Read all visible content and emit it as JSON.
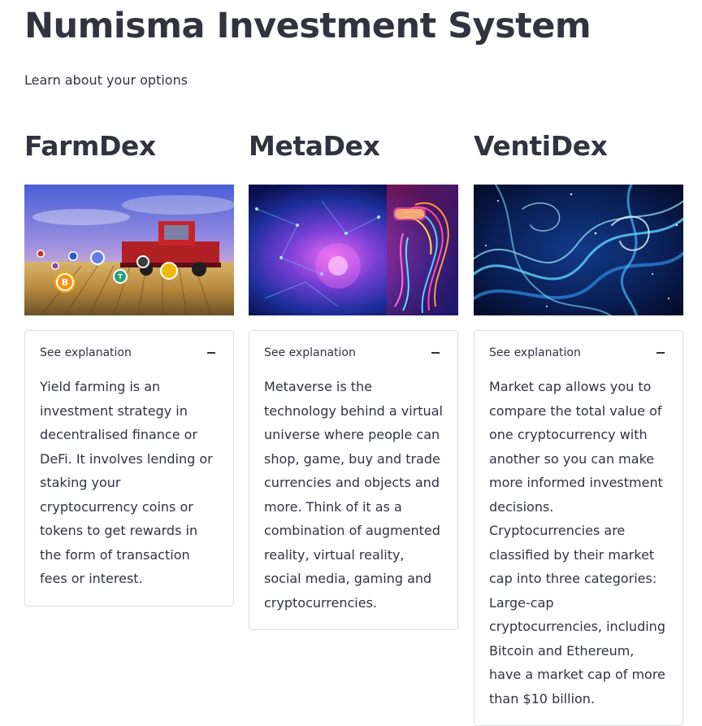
{
  "header": {
    "title": "Numisma Investment System",
    "subtitle": "Learn about your options"
  },
  "columns": [
    {
      "title": "FarmDex",
      "expander_label": "See explanation",
      "explanation": "Yield farming is an investment strategy in decentralised finance or DeFi. It involves lending or staking your cryptocurrency coins or tokens to get rewards in the form of transaction fees or interest."
    },
    {
      "title": "MetaDex",
      "expander_label": "See explanation",
      "explanation": "Metaverse is the technology behind a virtual universe where people can shop, game, buy and trade currencies and objects and more. Think of it as a combination of augmented reality, virtual reality, social media, gaming and cryptocurrencies."
    },
    {
      "title": "VentiDex",
      "expander_label": "See explanation",
      "explanation": "Market cap allows you to compare the total value of one cryptocurrency with another so you can make more informed investment decisions. Cryptocurrencies are classified by their market cap into three categories: Large-cap cryptocurrencies, including Bitcoin and Ethereum, have a market cap of more than $10 billion."
    }
  ],
  "icons": {
    "expander_toggle": "minus-icon",
    "coin_bitcoin": "B",
    "coin_tether": "T"
  }
}
